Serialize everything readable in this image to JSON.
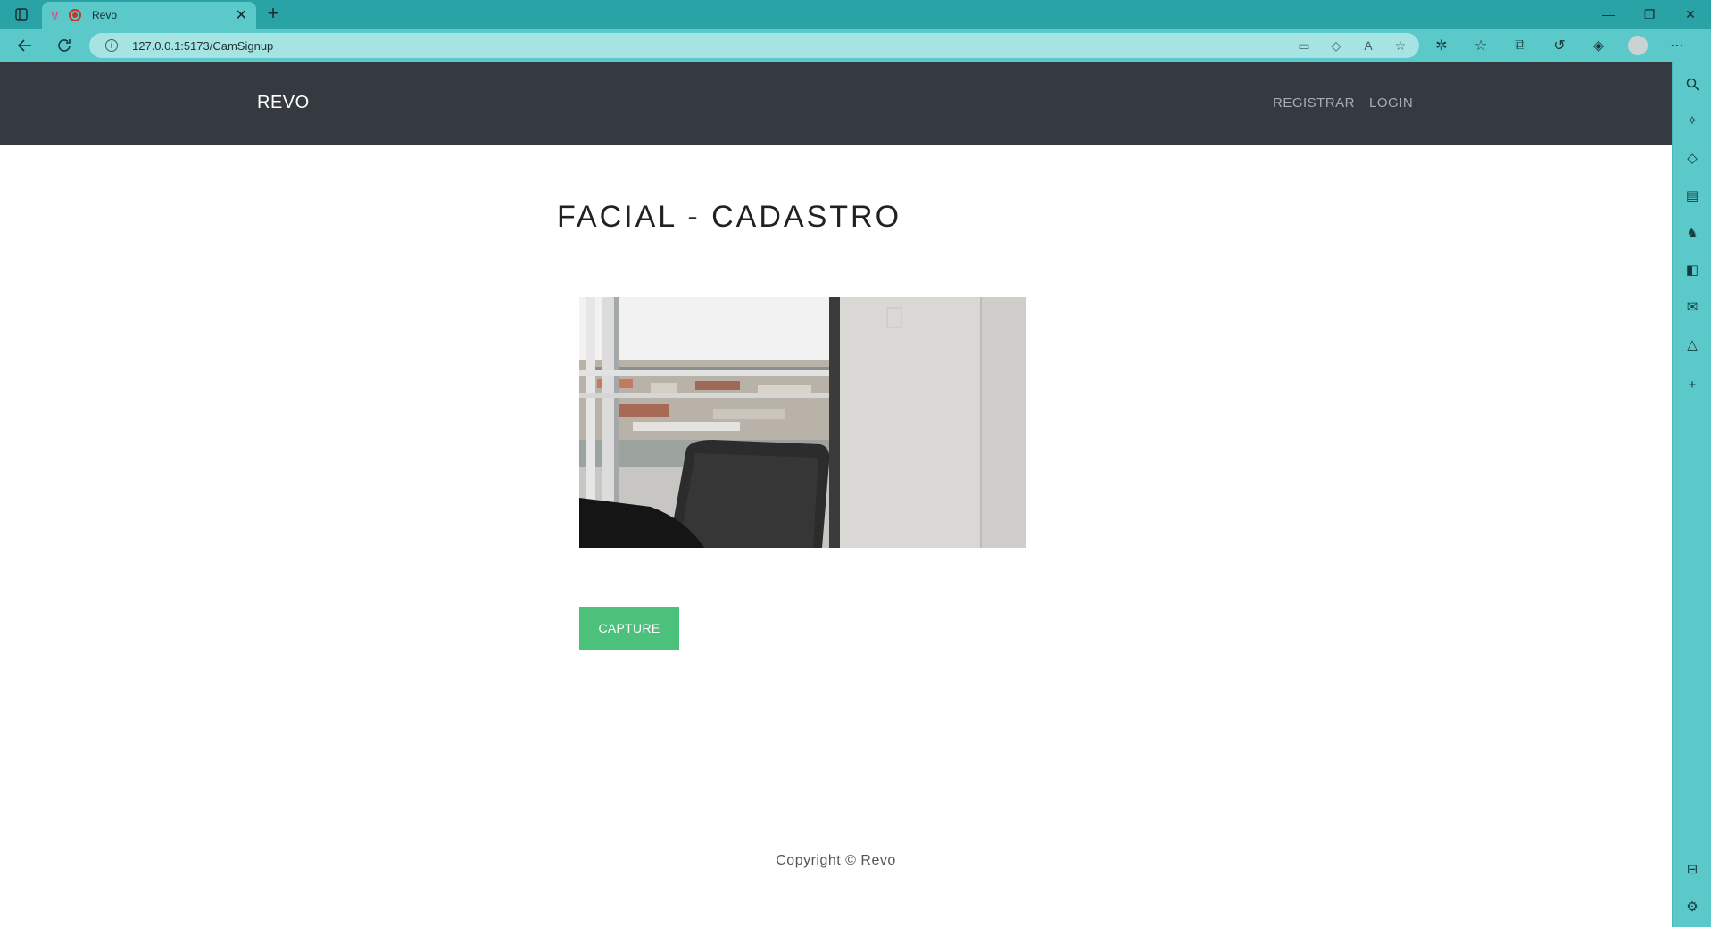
{
  "browser": {
    "tab_title": "Revo",
    "url": "127.0.0.1:5173/CamSignup"
  },
  "navbar": {
    "brand": "REVO",
    "links": [
      "REGISTRAR",
      "LOGIN"
    ]
  },
  "main": {
    "title": "FACIAL - CADASTRO",
    "capture_label": "CAPTURE"
  },
  "footer": {
    "copyright": "Copyright © Revo"
  },
  "colors": {
    "browser_accent": "#5bc9ca",
    "navbar_bg": "#343a40",
    "capture_button": "#4cc17c"
  }
}
